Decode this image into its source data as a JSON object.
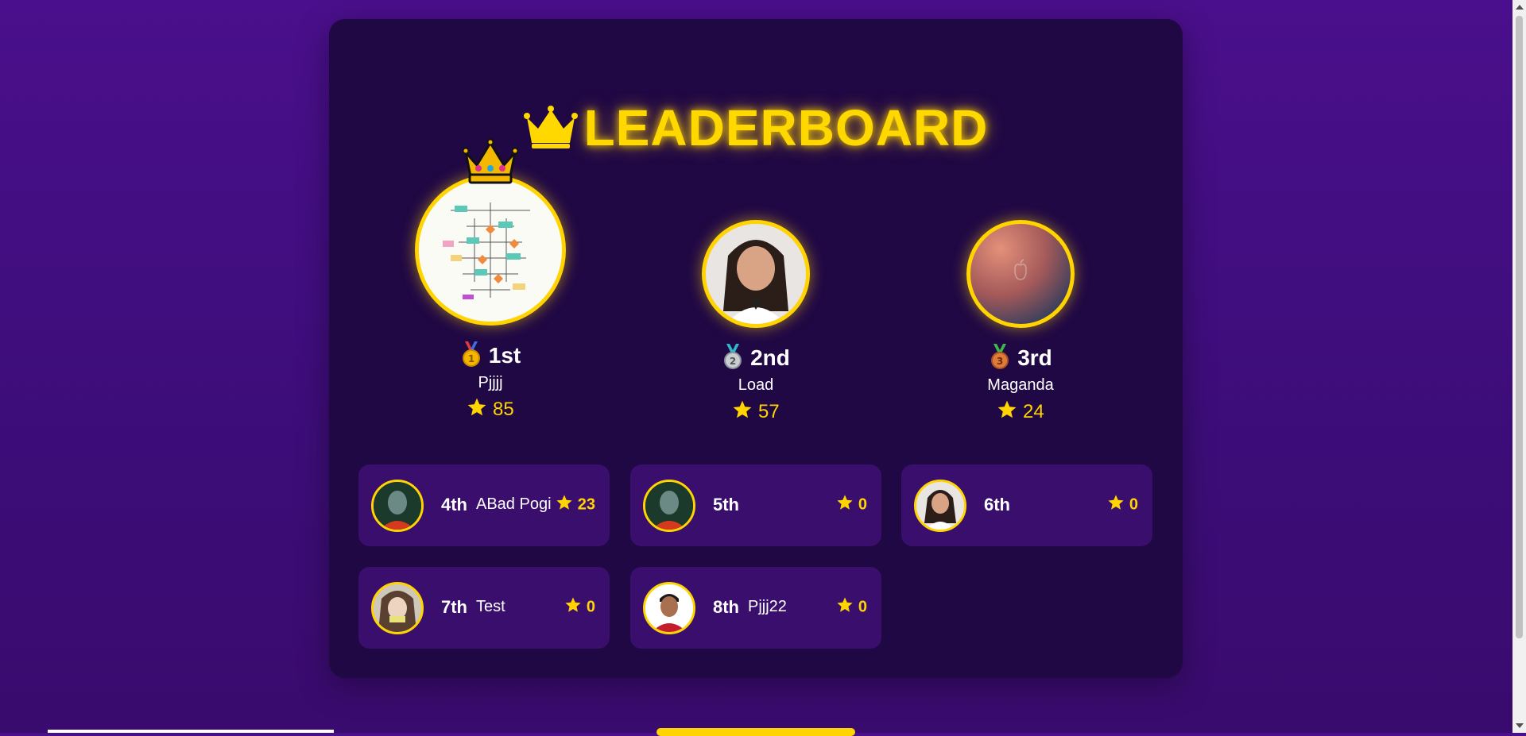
{
  "header": {
    "title": "LEADERBOARD"
  },
  "podium": [
    {
      "rank": "1st",
      "name": "Pjjjj",
      "score": "85"
    },
    {
      "rank": "2nd",
      "name": "Load",
      "score": "57"
    },
    {
      "rank": "3rd",
      "name": "Maganda",
      "score": "24"
    }
  ],
  "list": [
    {
      "rank": "4th",
      "name": "ABad Pogi",
      "score": "23"
    },
    {
      "rank": "5th",
      "name": "",
      "score": "0"
    },
    {
      "rank": "6th",
      "name": "",
      "score": "0"
    },
    {
      "rank": "7th",
      "name": "Test",
      "score": "0"
    },
    {
      "rank": "8th",
      "name": "Pjjj22",
      "score": "0"
    }
  ],
  "colors": {
    "gold": "#ffd400",
    "panel": "#200844",
    "card": "#3a0e6c",
    "background": "#4a0f8c"
  },
  "icons": [
    "crown-icon",
    "gold-medal-icon",
    "silver-medal-icon",
    "bronze-medal-icon",
    "star-icon"
  ]
}
